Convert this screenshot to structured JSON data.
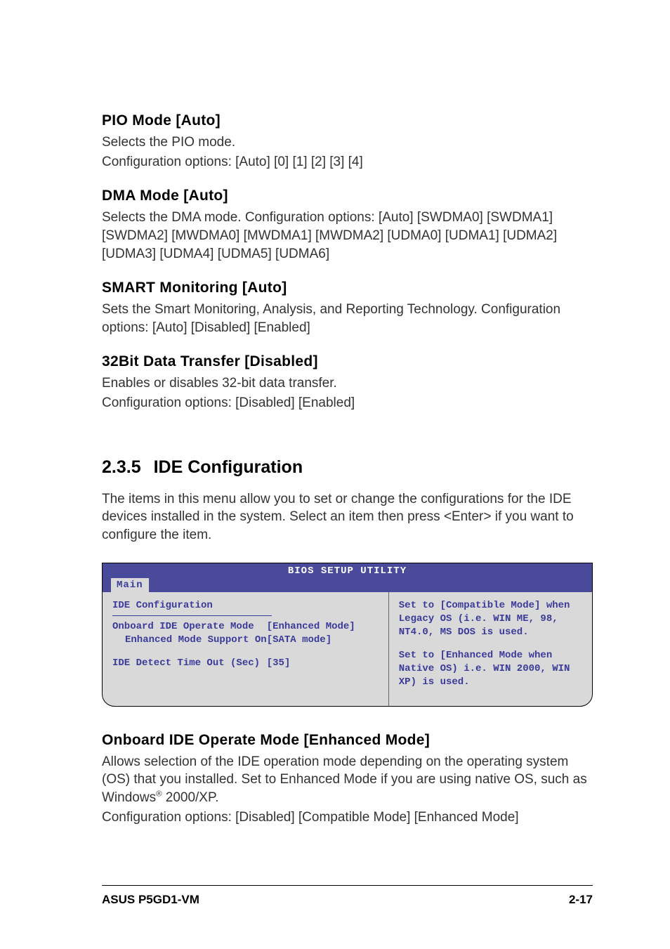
{
  "sections": {
    "pio": {
      "heading": "PIO Mode [Auto]",
      "line1": "Selects the PIO mode.",
      "line2": "Configuration options: [Auto] [0] [1] [2] [3] [4]"
    },
    "dma": {
      "heading": "DMA Mode [Auto]",
      "line1": "Selects the DMA mode. Configuration options: [Auto] [SWDMA0] [SWDMA1] [SWDMA2] [MWDMA0] [MWDMA1] [MWDMA2] [UDMA0] [UDMA1] [UDMA2] [UDMA3] [UDMA4] [UDMA5] [UDMA6]"
    },
    "smart": {
      "heading": "SMART Monitoring [Auto]",
      "line1": "Sets the Smart Monitoring, Analysis, and Reporting Technology. Configuration options: [Auto] [Disabled] [Enabled]"
    },
    "d32": {
      "heading": "32Bit Data Transfer [Disabled]",
      "line1": "Enables or disables 32-bit data transfer.",
      "line2": "Configuration options: [Disabled] [Enabled]"
    }
  },
  "main": {
    "num": "2.3.5",
    "title": "IDE Configuration",
    "intro": "The items in this menu allow you to set or change the configurations for the IDE devices installed in the system. Select an item then press <Enter> if you want to configure the item."
  },
  "bios": {
    "title": "BIOS SETUP UTILITY",
    "tab": "Main",
    "leftTitle": "IDE Configuration",
    "rows": {
      "r1": {
        "label": "Onboard IDE Operate Mode",
        "value": "[Enhanced Mode]"
      },
      "r2": {
        "label": "Enhanced Mode Support On",
        "value": "[SATA mode]"
      },
      "r3": {
        "label": "IDE Detect Time Out (Sec)",
        "value": "[35]"
      }
    },
    "help1": "Set to [Compatible Mode] when Legacy OS (i.e. WIN ME, 98, NT4.0, MS DOS is used.",
    "help2": "Set to [Enhanced Mode when Native OS) i.e. WIN 2000, WIN XP) is used."
  },
  "onboard": {
    "heading": "Onboard IDE Operate Mode [Enhanced Mode]",
    "line1a": "Allows selection of the IDE operation mode depending on the operating system (OS) that you installed. Set to Enhanced Mode if you are using native OS, such as Windows",
    "line1b": " 2000/XP.",
    "line2": "Configuration options: [Disabled] [Compatible Mode] [Enhanced Mode]"
  },
  "footer": {
    "left": "ASUS P5GD1-VM",
    "right": "2-17"
  }
}
